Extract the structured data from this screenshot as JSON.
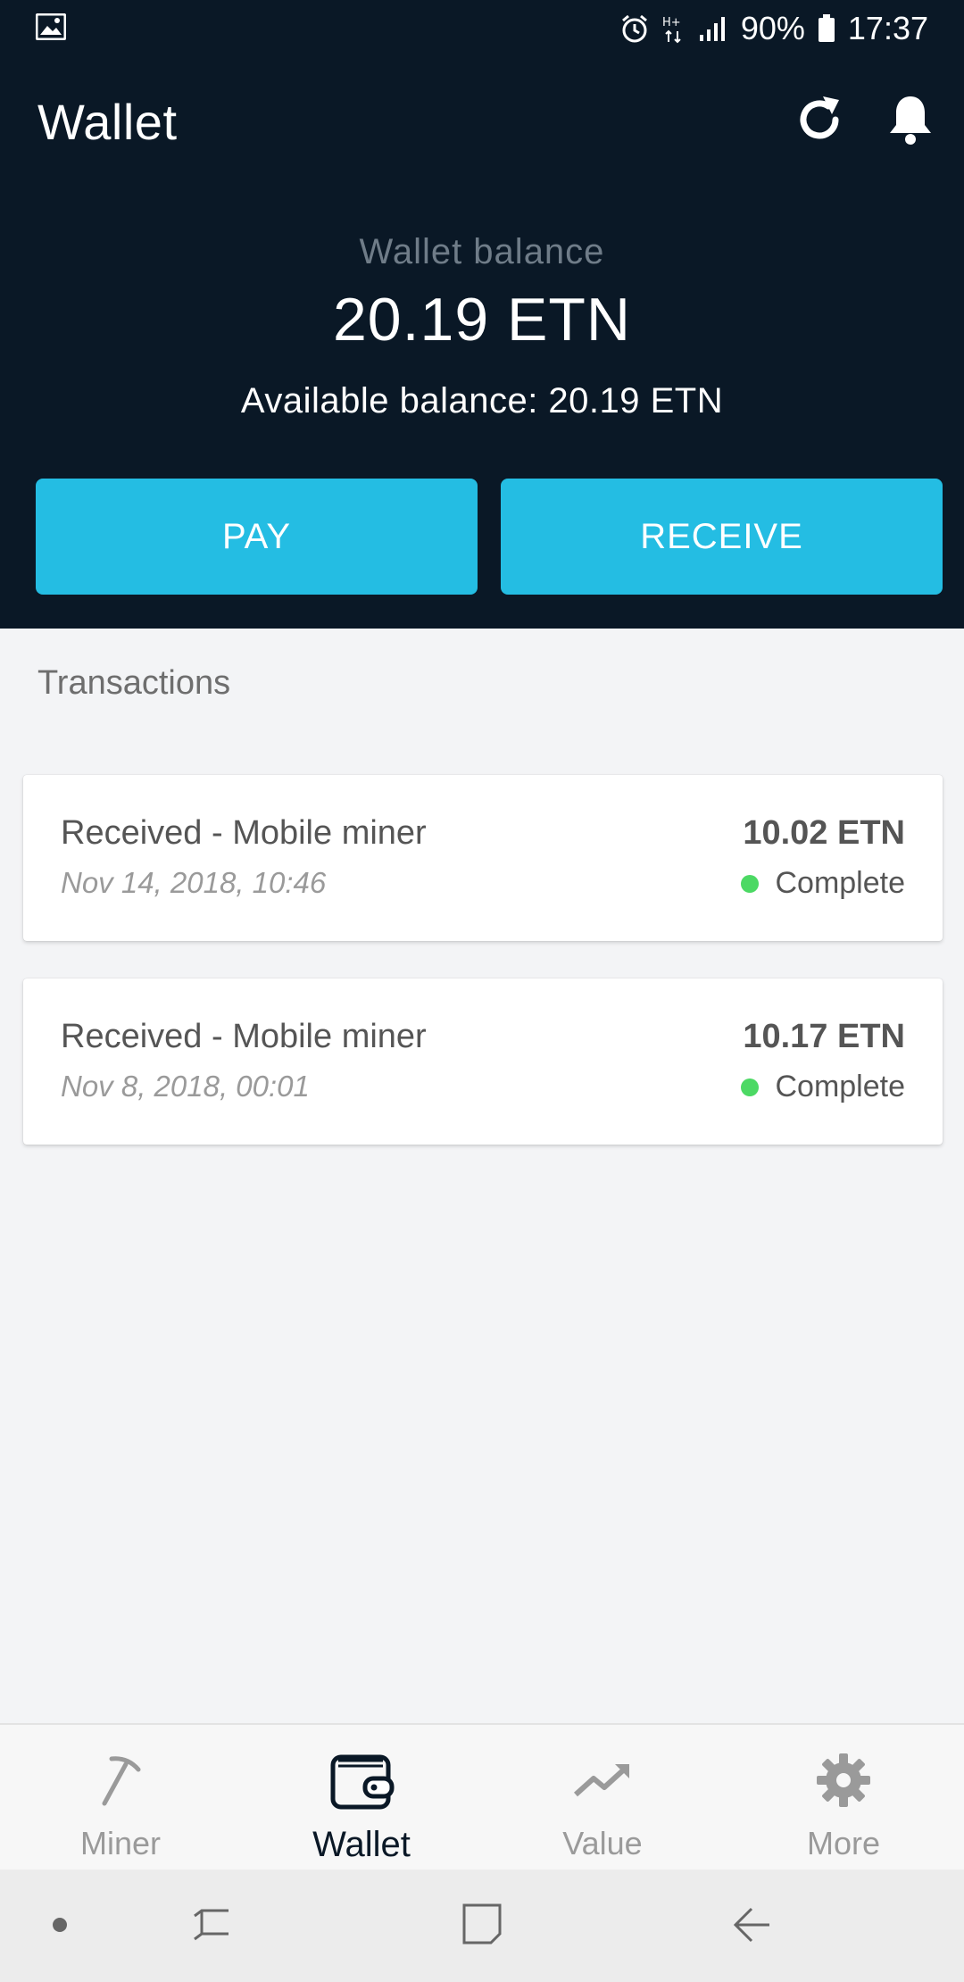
{
  "status_bar": {
    "battery": "90%",
    "time": "17:37"
  },
  "header": {
    "title": "Wallet",
    "balance_label": "Wallet balance",
    "balance_value": "20.19 ETN",
    "available_balance": "Available balance: 20.19 ETN",
    "pay_label": "PAY",
    "receive_label": "RECEIVE"
  },
  "transactions": {
    "section_title": "Transactions",
    "items": [
      {
        "title": "Received - Mobile miner",
        "date": "Nov 14, 2018, 10:46",
        "amount": "10.02 ETN",
        "status": "Complete"
      },
      {
        "title": "Received - Mobile miner",
        "date": "Nov 8, 2018, 00:01",
        "amount": "10.17 ETN",
        "status": "Complete"
      }
    ]
  },
  "bottom_nav": {
    "items": [
      {
        "label": "Miner",
        "icon": "pickaxe-icon",
        "active": false
      },
      {
        "label": "Wallet",
        "icon": "wallet-icon",
        "active": true
      },
      {
        "label": "Value",
        "icon": "trend-up-icon",
        "active": false
      },
      {
        "label": "More",
        "icon": "gear-icon",
        "active": false
      }
    ]
  },
  "colors": {
    "header_bg": "#0a1826",
    "accent": "#24bde3",
    "status_complete": "#4cd964",
    "page_bg": "#f3f4f6"
  }
}
